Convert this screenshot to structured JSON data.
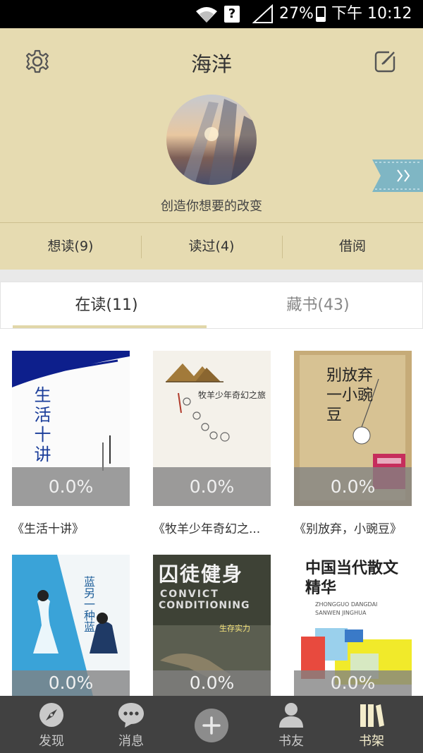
{
  "status_bar": {
    "battery": "27%",
    "time": "下午 10:12",
    "battery_level": 0.27
  },
  "profile": {
    "name": "海洋",
    "motto": "创造你想要的改变",
    "stats": [
      {
        "label": "想读(9)"
      },
      {
        "label": "读过(4)"
      },
      {
        "label": "借阅"
      }
    ]
  },
  "tabs": [
    {
      "label": "在读(11)",
      "active": true
    },
    {
      "label": "藏书(43)",
      "active": false
    }
  ],
  "books": [
    {
      "title": "《生活十讲》",
      "progress": "0.0%",
      "cover_text": "生活十讲"
    },
    {
      "title": "《牧羊少年奇幻之...",
      "progress": "0.0%",
      "cover_text": "牧羊少年奇幻之旅"
    },
    {
      "title": "《别放弃，小豌豆》",
      "progress": "0.0%",
      "cover_text": "别放弃一小豌豆"
    },
    {
      "title": "",
      "progress": "0.0%",
      "cover_text": "蓝另一种蓝"
    },
    {
      "title": "",
      "progress": "0.0%",
      "cover_text": "囚徒健身",
      "cover_sub1": "CONVICT",
      "cover_sub2": "CONDITIONING",
      "cover_sub3": "生存实力"
    },
    {
      "title": "",
      "progress": "0.0%",
      "cover_text": "中国当代散文精华",
      "cover_sub1": "ZHONGGUO DANGDAI",
      "cover_sub2": "SANWEN JINGHUA"
    }
  ],
  "bottom_nav": [
    {
      "label": "发现",
      "icon": "compass-icon"
    },
    {
      "label": "消息",
      "icon": "chat-bubble-icon"
    },
    {
      "label": "",
      "icon": "plus-icon"
    },
    {
      "label": "书友",
      "icon": "person-icon"
    },
    {
      "label": "书架",
      "icon": "bookshelf-icon",
      "active": true
    }
  ],
  "colors": {
    "header_bg": "#e6dbb1",
    "nav_bg": "#414141",
    "accent": "#e1d7a9",
    "ribbon": "#7fb6c4"
  }
}
